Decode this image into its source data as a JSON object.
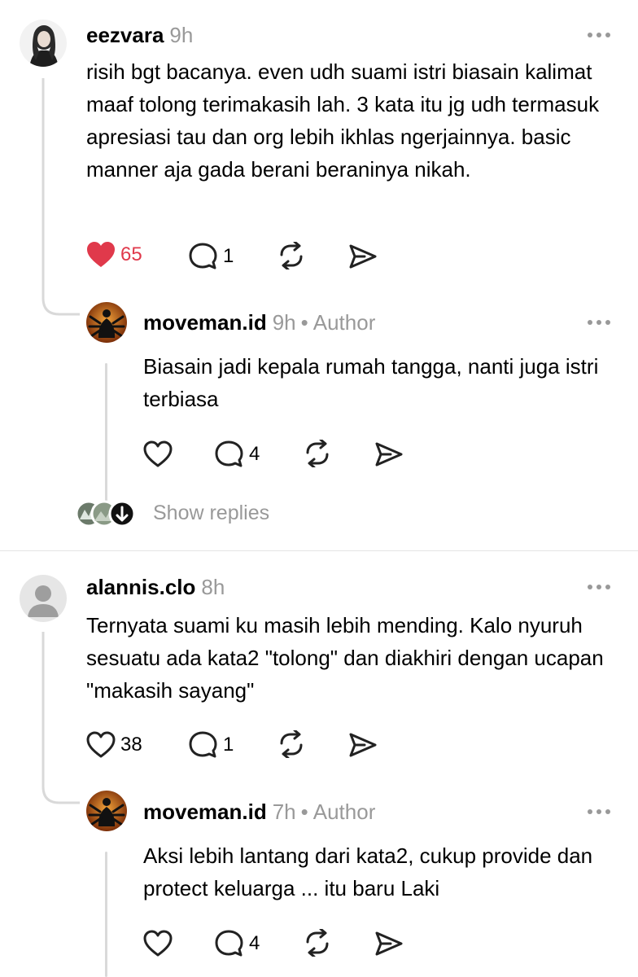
{
  "comments": [
    {
      "username": "eezvara",
      "time": "9h",
      "text": "risih bgt bacanya. even udh suami istri biasain kalimat maaf tolong terimakasih lah. 3 kata itu jg udh termasuk apresiasi tau dan org lebih ikhlas ngerjainnya. basic manner aja gada berani beraninya nikah.",
      "likes": "65",
      "liked": true,
      "replies": "1",
      "reply": {
        "username": "moveman.id",
        "time": "9h",
        "dot": "•",
        "tag": "Author",
        "text": "Biasain jadi kepala rumah tangga, nanti juga istri terbiasa",
        "replies": "4",
        "show_replies": "Show replies"
      }
    },
    {
      "username": "alannis.clo",
      "time": "8h",
      "text": "Ternyata suami ku masih lebih mending. Kalo nyuruh sesuatu ada kata2 \"tolong\"  dan diakhiri dengan ucapan \"makasih sayang\"",
      "likes": "38",
      "liked": false,
      "replies": "1",
      "reply": {
        "username": "moveman.id",
        "time": "7h",
        "dot": "•",
        "tag": "Author",
        "text": "Aksi lebih lantang dari kata2, cukup provide dan protect keluarga ... itu baru Laki",
        "replies": "4"
      }
    }
  ],
  "icons": {
    "like": "heart-icon",
    "reply": "comment-icon",
    "repost": "repost-icon",
    "share": "send-icon",
    "more": "more-icon",
    "expand": "arrow-down-icon"
  },
  "colors": {
    "liked": "#e0394b",
    "muted": "#999999"
  }
}
